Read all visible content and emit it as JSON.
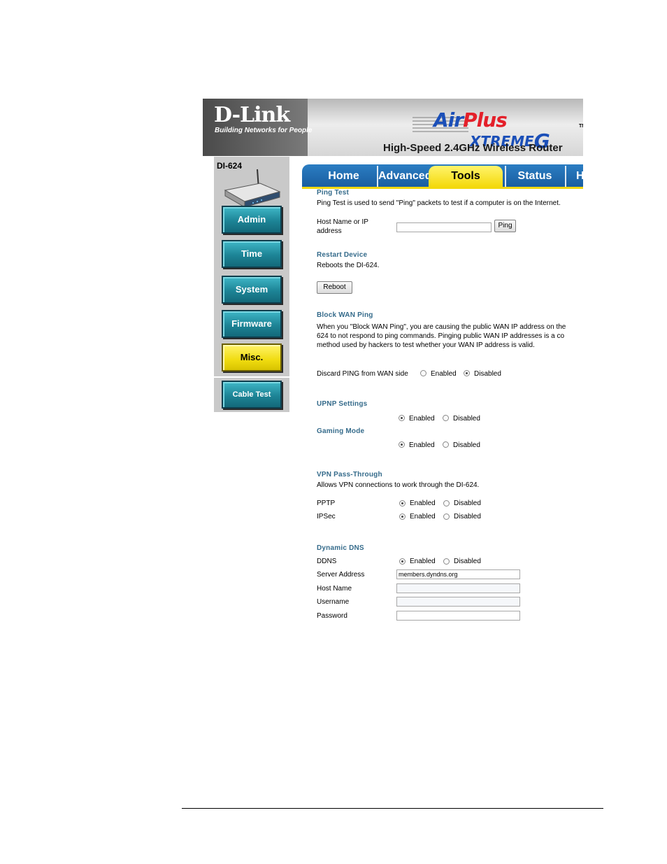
{
  "header": {
    "logo": "D-Link",
    "tagline": "Building Networks for People",
    "brand_air": "Air",
    "brand_plus": "Plus",
    "brand_xtreme": "XTREME",
    "brand_g": "G",
    "brand_tm": "TM",
    "product_title": "High-Speed 2.4GHz Wireless Router"
  },
  "sidebar": {
    "model": "DI-624",
    "items": [
      {
        "label": "Admin",
        "active": false
      },
      {
        "label": "Time",
        "active": false
      },
      {
        "label": "System",
        "active": false
      },
      {
        "label": "Firmware",
        "active": false
      },
      {
        "label": "Misc.",
        "active": true
      }
    ],
    "extra_item": {
      "label": "Cable Test"
    }
  },
  "tabs": [
    {
      "label": "Home",
      "active": false
    },
    {
      "label": "Advanced",
      "active": false
    },
    {
      "label": "Tools",
      "active": true
    },
    {
      "label": "Status",
      "active": false
    },
    {
      "label": "H",
      "active": false
    }
  ],
  "ping_test": {
    "title": "Ping Test",
    "description": "Ping Test is used to send \"Ping\" packets to test if a computer is on the Internet.",
    "host_label_1": "Host Name or IP",
    "host_label_2": "address",
    "host_value": "",
    "button": "Ping"
  },
  "restart": {
    "title": "Restart Device",
    "description": "Reboots the DI-624.",
    "button": "Reboot"
  },
  "block_wan_ping": {
    "title": "Block WAN Ping",
    "line1": "When you \"Block WAN Ping\", you are causing the public WAN IP address on the",
    "line2": "624 to not respond to ping commands. Pinging public WAN IP addresses is a co",
    "line3": "method used by hackers to test whether your WAN IP address is valid.",
    "discard_label": "Discard PING from WAN side",
    "enabled": "Enabled",
    "disabled": "Disabled",
    "selected": "Disabled"
  },
  "upnp": {
    "title": "UPNP Settings",
    "enabled": "Enabled",
    "disabled": "Disabled",
    "selected": "Enabled"
  },
  "gaming": {
    "title": "Gaming Mode",
    "enabled": "Enabled",
    "disabled": "Disabled",
    "selected": "Enabled"
  },
  "vpn": {
    "title": "VPN Pass-Through",
    "description": "Allows VPN connections to work through the DI-624.",
    "pptp_label": "PPTP",
    "ipsec_label": "IPSec",
    "enabled": "Enabled",
    "disabled": "Disabled",
    "pptp_selected": "Enabled",
    "ipsec_selected": "Enabled"
  },
  "ddns": {
    "title": "Dynamic DNS",
    "ddns_label": "DDNS",
    "enabled": "Enabled",
    "disabled": "Disabled",
    "selected": "Enabled",
    "server_label": "Server Address",
    "server_value": "members.dyndns.org",
    "host_label": "Host Name",
    "host_value": "",
    "user_label": "Username",
    "user_value": "",
    "pass_label": "Password",
    "pass_value": ""
  }
}
